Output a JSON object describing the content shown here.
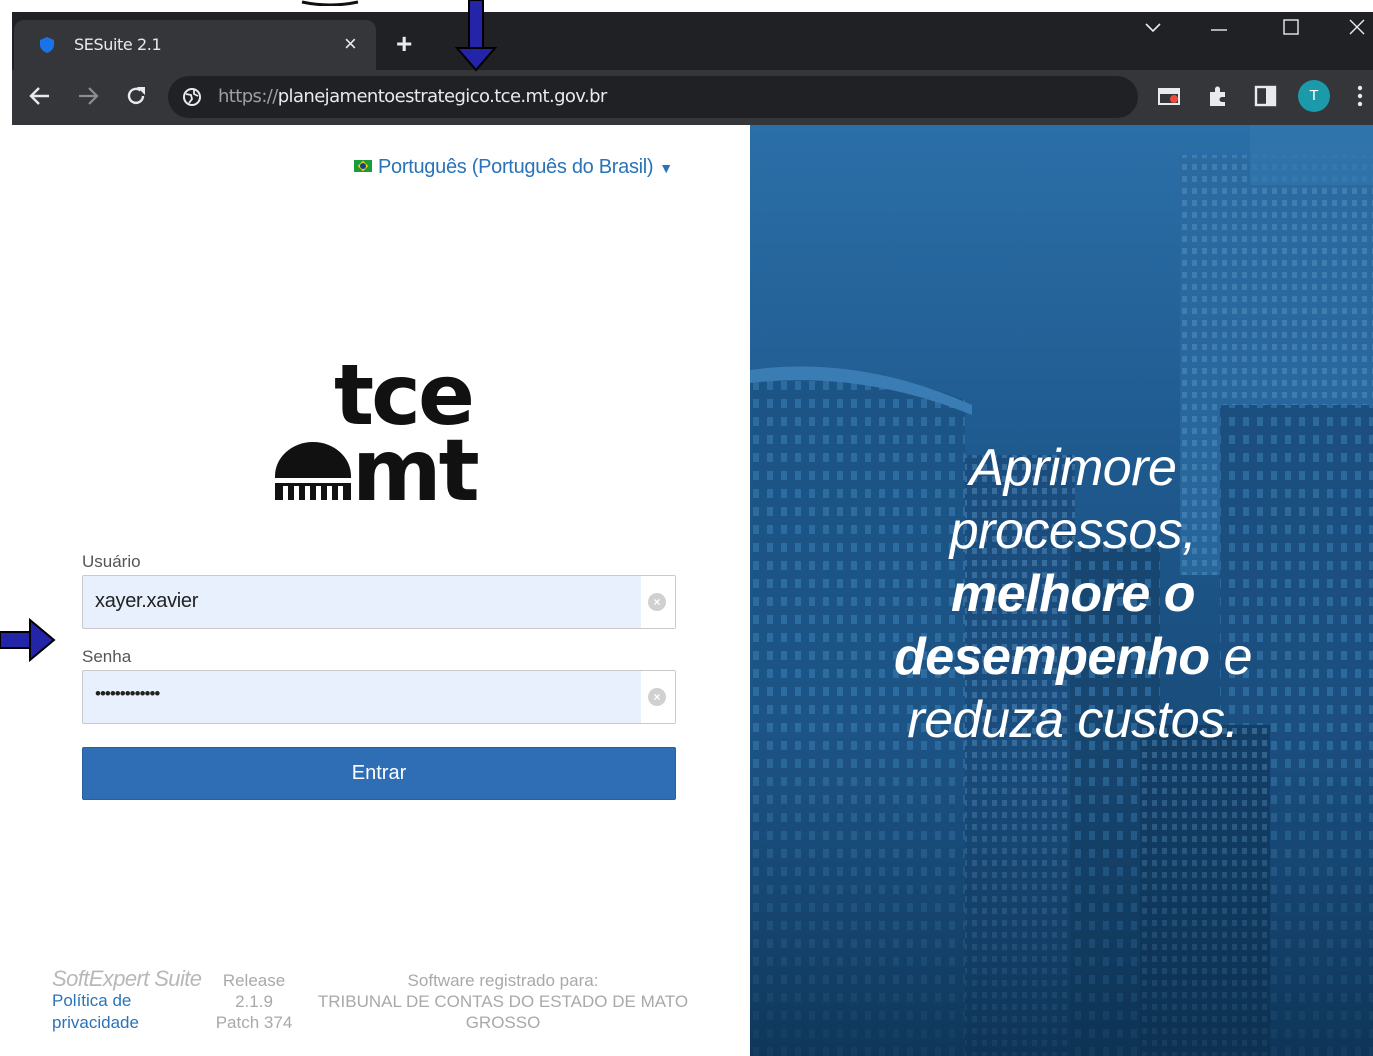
{
  "browser": {
    "tab_title": "SESuite 2.1",
    "tab_close": "×",
    "new_tab": "+",
    "url_scheme": "https://",
    "url_host": "planejamentoestrategico.tce.mt.gov.br",
    "avatar_letter": "T"
  },
  "login": {
    "language": "Português (Português do Brasil)",
    "logo_line1": "tce",
    "logo_line2": "mt",
    "username_label": "Usuário",
    "username_value": "xayer.xavier",
    "password_label": "Senha",
    "password_value": "•••••••••••••",
    "submit_label": "Entrar"
  },
  "footer": {
    "brand": "SoftExpert Suite",
    "privacy_line1": "Política de",
    "privacy_line2": "privacidade",
    "release_line1": "Release",
    "release_line2": "2.1.9",
    "release_line3": "Patch 374",
    "registered_line1": "Software registrado para:",
    "registered_line2": "TRIBUNAL DE CONTAS DO ESTADO DE MATO",
    "registered_line3": "GROSSO"
  },
  "hero": {
    "line1": "Aprimore",
    "line2": "processos,",
    "line3_bold": "melhore o",
    "line4_bold": "desempenho",
    "line4_rest": " e",
    "line5": "reduza custos."
  },
  "colors": {
    "primary_button": "#2f6eb5",
    "link": "#2a73b8",
    "chrome_dark": "#202124",
    "annotation_arrow": "#2424a8"
  }
}
